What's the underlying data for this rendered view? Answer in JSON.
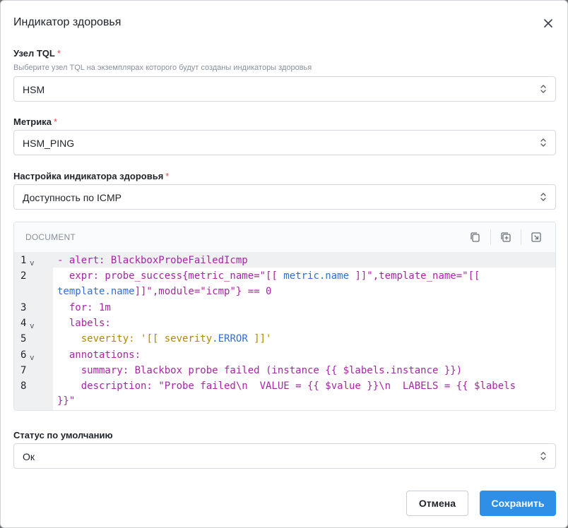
{
  "dialog": {
    "title": "Индикатор здоровья"
  },
  "tql_node": {
    "label": "Узел TQL",
    "required_mark": "*",
    "hint": "Выберите узел TQL на экземплярах которого будут созданы индикаторы здоровья",
    "value": "HSM"
  },
  "metric": {
    "label": "Метрика",
    "required_mark": "*",
    "value": "HSM_PING"
  },
  "health_setting": {
    "label": "Настройка индикатора здоровья",
    "required_mark": "*",
    "value": "Доступность по ICMP"
  },
  "editor": {
    "header": "DOCUMENT",
    "lines": [
      {
        "number": "1",
        "fold": "v"
      },
      {
        "number": "2",
        "fold": ""
      },
      {
        "number": "3",
        "fold": ""
      },
      {
        "number": "4",
        "fold": "v"
      },
      {
        "number": "5",
        "fold": ""
      },
      {
        "number": "6",
        "fold": "v"
      },
      {
        "number": "7",
        "fold": ""
      },
      {
        "number": "8",
        "fold": ""
      }
    ],
    "code": {
      "l1": "- alert: BlackboxProbeFailedIcmp",
      "l2a_pre": "  expr: probe_success{metric_name=\"[[ ",
      "l2a_var": "metric.name",
      "l2a_post": " ]]\",template_name=\"[[",
      "l2b_var": "template.name",
      "l2b_post": "]]\",module=\"icmp\"} == 0",
      "l3": "  for: 1m",
      "l4": "  labels:",
      "l5_pre": "    ",
      "l5_key": "severity",
      "l5_mid": ": '[[ ",
      "l5_sev": "severity",
      "l5_dot": ".",
      "l5_var": "ERROR",
      "l5_post": " ]]'",
      "l6": "  annotations:",
      "l7": "    summary: Blackbox probe failed (instance {{ $labels.instance }})",
      "l8a": "    description: \"Probe failed\\n  VALUE = {{ $value }}\\n  LABELS = {{ $labels",
      "l8b": "}}\""
    }
  },
  "default_status": {
    "label": "Статус по умолчанию",
    "value": "Ок"
  },
  "footer": {
    "cancel_label": "Отмена",
    "save_label": "Сохранить"
  },
  "colors": {
    "accent": "#2f8fe6",
    "required": "#e5484d",
    "code_text": "#a626a4",
    "code_variable": "#2f6fd6",
    "code_severity": "#b08800"
  },
  "icons": [
    "close-icon",
    "chevron-updown-icon",
    "copy-icon",
    "duplicate-icon",
    "expand-icon",
    "fold-chevron-icon"
  ]
}
